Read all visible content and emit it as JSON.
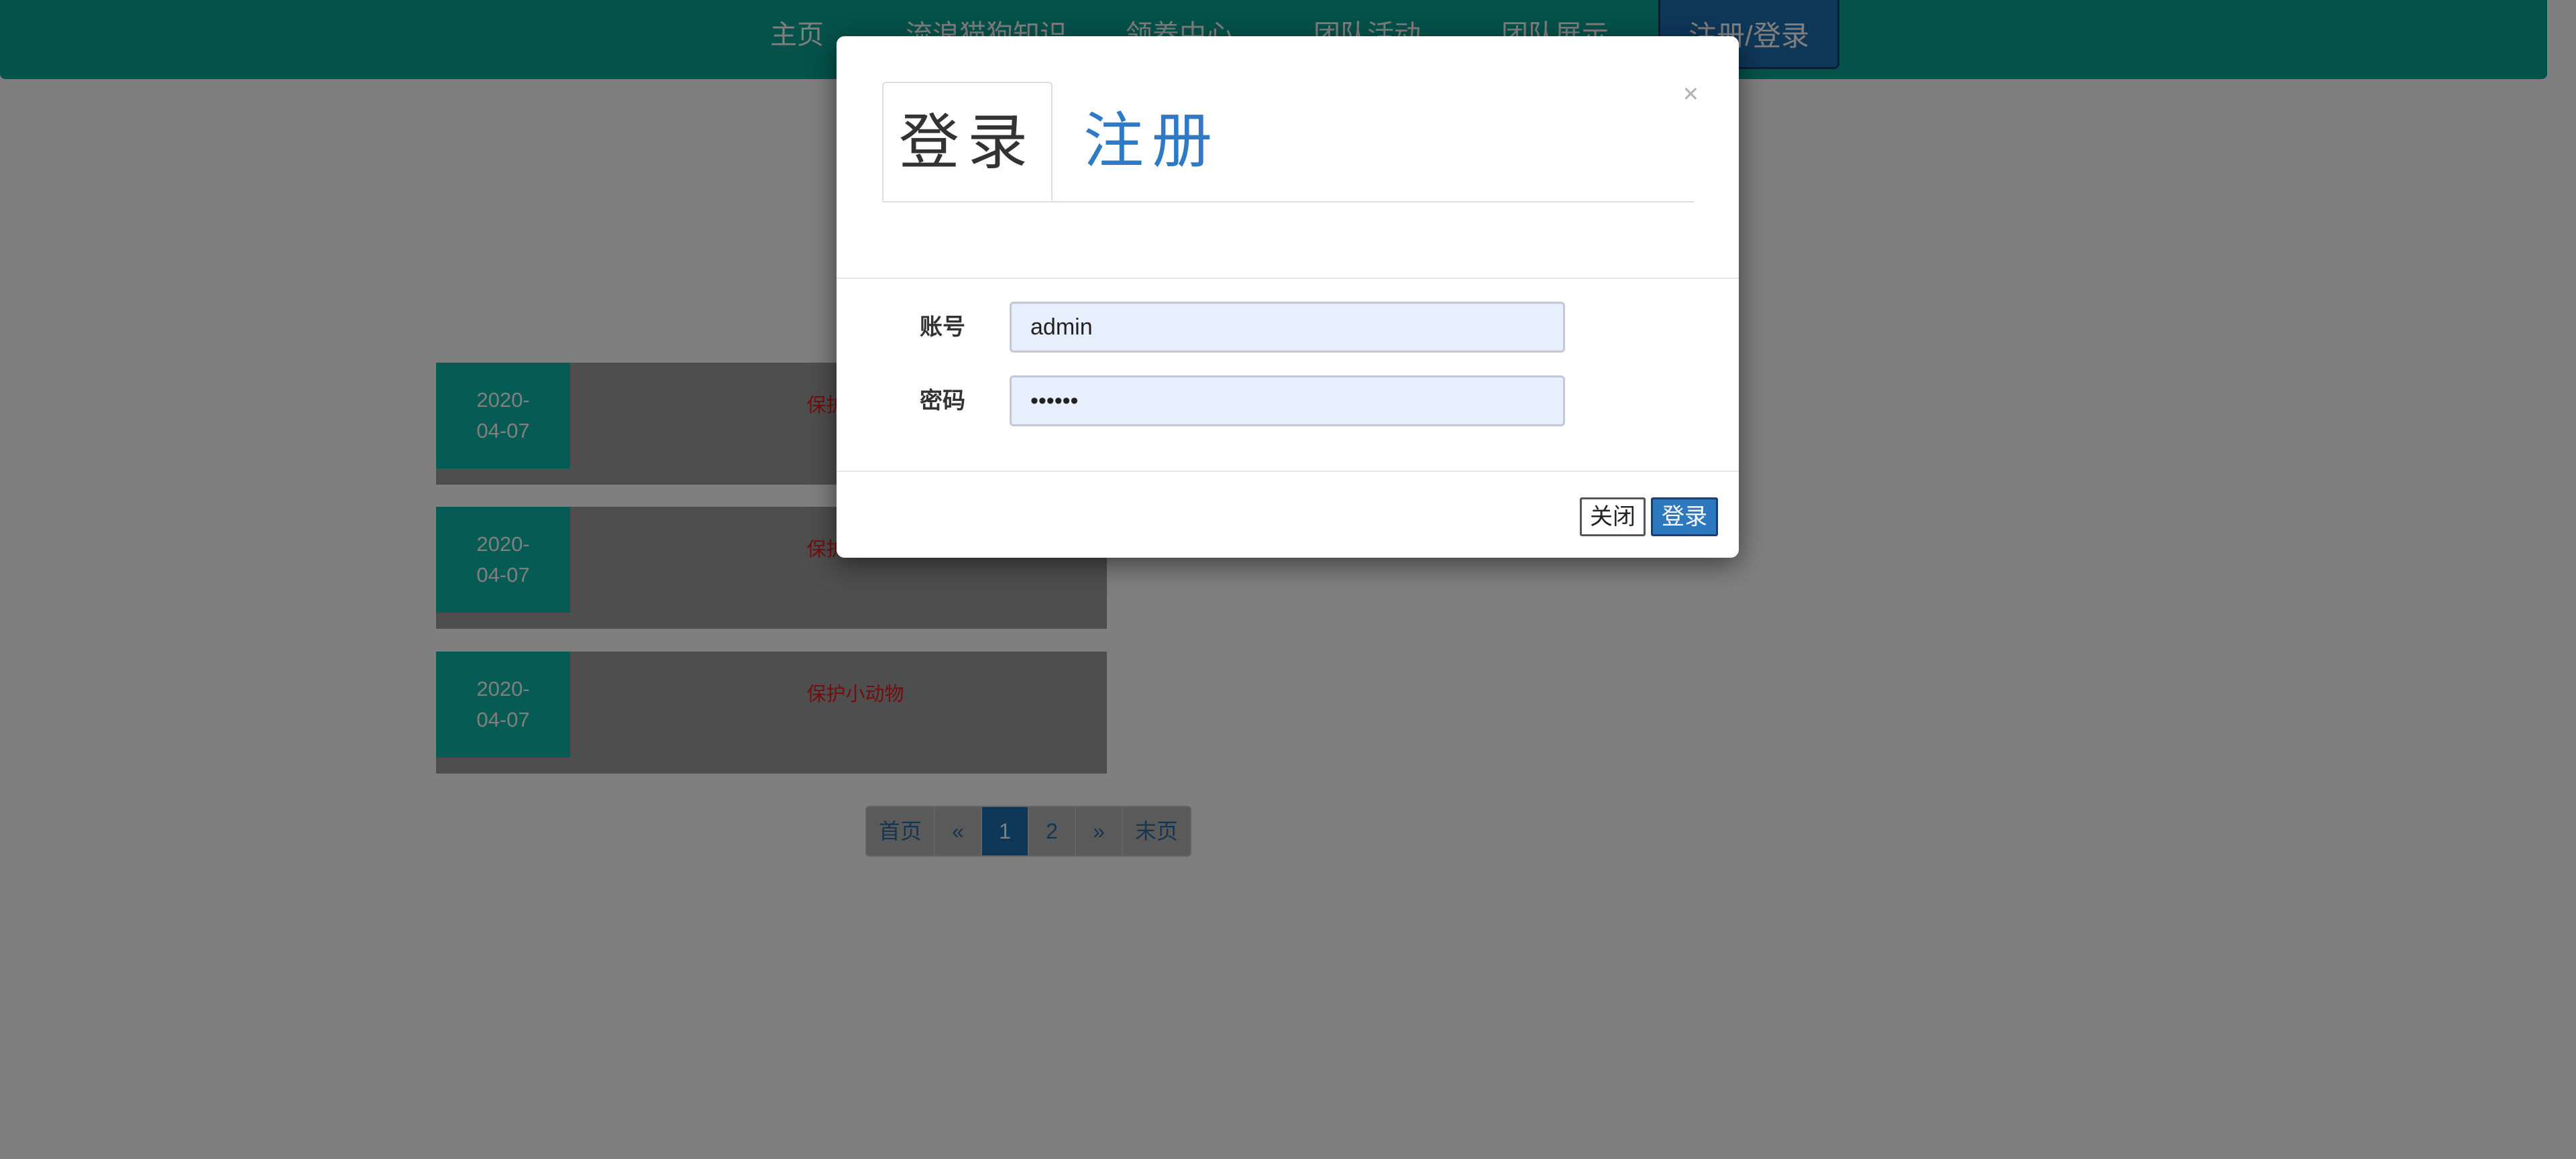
{
  "nav": {
    "items": [
      {
        "label": "主页"
      },
      {
        "label": "流浪猫狗知识"
      },
      {
        "label": "领养中心"
      },
      {
        "label": "团队活动"
      },
      {
        "label": "团队展示"
      }
    ],
    "login_label": "注册/登录"
  },
  "cards": [
    {
      "date_line1": "2020-",
      "date_line2": "04-07",
      "title": "保护小动物",
      "desc": ""
    },
    {
      "date_line1": "2020-",
      "date_line2": "04-07",
      "title": "保护小动物",
      "desc": ""
    },
    {
      "date_line1": "2020-",
      "date_line2": "04-07",
      "title": "保护小动物",
      "desc": ""
    }
  ],
  "pagination": {
    "first": "首页",
    "prev": "«",
    "pages": [
      "1",
      "2"
    ],
    "current": "1",
    "next": "»",
    "last": "末页"
  },
  "modal": {
    "tab_login": "登录",
    "tab_register": "注册",
    "close_symbol": "×",
    "account_label": "账号",
    "account_value": "admin",
    "password_label": "密码",
    "password_value": "••••••",
    "btn_close": "关闭",
    "btn_login": "登录"
  },
  "colors": {
    "nav_bg": "#0aa597",
    "date_bg": "#0fb7aa",
    "primary": "#2e78c0",
    "title_red": "#e02020"
  }
}
